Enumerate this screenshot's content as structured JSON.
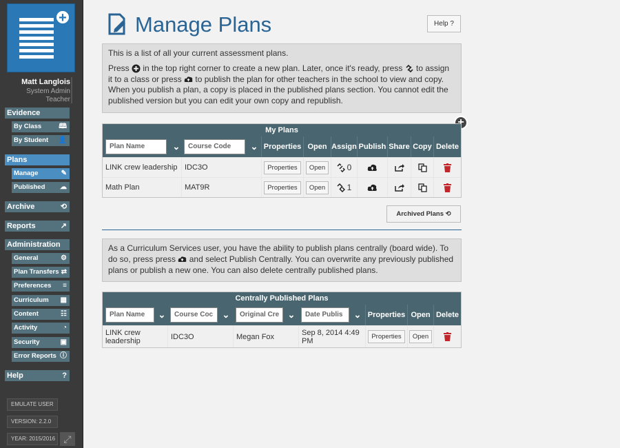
{
  "sidebar": {
    "user_name": "Matt Langlois",
    "roles": [
      "System Admin",
      "Teacher"
    ],
    "sections": [
      {
        "label": "Evidence",
        "items": [
          {
            "label": "By Class",
            "icon": "book-icon"
          },
          {
            "label": "By Student",
            "icon": "person-icon"
          }
        ]
      },
      {
        "label": "Plans",
        "items": [
          {
            "label": "Manage",
            "icon": "edit-icon"
          },
          {
            "label": "Published",
            "icon": "cloud-icon"
          }
        ]
      },
      {
        "label": "Archive",
        "icon": "restore-icon"
      },
      {
        "label": "Reports",
        "icon": "chart-icon"
      },
      {
        "label": "Administration",
        "items": [
          {
            "label": "General",
            "icon": "gear-icon"
          },
          {
            "label": "Plan Transfers",
            "icon": "transfer-icon"
          },
          {
            "label": "Preferences",
            "icon": "sliders-icon"
          },
          {
            "label": "Curriculum",
            "icon": "calendar-icon"
          },
          {
            "label": "Content",
            "icon": "database-icon"
          },
          {
            "label": "Activity",
            "icon": "pie-icon"
          },
          {
            "label": "Security",
            "icon": "lock-icon"
          },
          {
            "label": "Error Reports",
            "icon": "alert-icon"
          }
        ]
      },
      {
        "label": "Help",
        "icon": "question-icon"
      }
    ],
    "footer": [
      "EMULATE USER",
      "VERSION: 2.2.0",
      "YEAR: 2015/2016"
    ]
  },
  "header": {
    "title": "Manage Plans",
    "help_label": "Help ?"
  },
  "intro": {
    "line1": "This is a list of all your current assessment plans.",
    "p_press": "Press",
    "p_part1": "in the top right corner to create a new plan. Later, once it's ready, press",
    "p_part2": "to assign it to a class or press",
    "p_part3": "to publish the plan for other teachers in the school to view and copy. When you publish a plan, a copy is placed in the published plans section. You cannot edit the published version but you can edit your own copy and republish."
  },
  "my_plans": {
    "title": "My Plans",
    "filters": {
      "plan_name": "Plan Name",
      "course_code": "Course Code"
    },
    "headers": {
      "properties": "Properties",
      "open": "Open",
      "assign": "Assign",
      "publish": "Publish",
      "share": "Share",
      "copy": "Copy",
      "delete": "Delete"
    },
    "rows": [
      {
        "name": "LINK crew leadership",
        "course": "IDC3O",
        "properties": "Properties",
        "open": "Open",
        "assign_count": "0"
      },
      {
        "name": "Math Plan",
        "course": "MAT9R",
        "properties": "Properties",
        "open": "Open",
        "assign_count": "1"
      }
    ]
  },
  "archived_label": "Archived Plans ⟲",
  "curriculum_note": {
    "part1": "As a Curriculum Services user, you have the ability to publish plans centrally (board wide). To do so, press press",
    "part2": "and select Publish Centrally. You can overwrite any previously published plans or publish a new one. You can also delete centrally published plans."
  },
  "central_plans": {
    "title": "Centrally Published Plans",
    "filters": {
      "plan_name": "Plan Name",
      "course_code": "Course Coc",
      "original_creator": "Original Cre",
      "date_published": "Date Publis"
    },
    "headers": {
      "properties": "Properties",
      "open": "Open",
      "delete": "Delete"
    },
    "rows": [
      {
        "name": "LINK crew leadership",
        "course": "IDC3O",
        "creator": "Megan Fox",
        "date": "Sep 8, 2014 4:49 PM",
        "properties": "Properties",
        "open": "Open"
      }
    ]
  },
  "colors": {
    "accent": "#2a6494",
    "table_header": "#496670",
    "sidebar_active": "#4b8ec2",
    "delete": "#c0272d"
  }
}
